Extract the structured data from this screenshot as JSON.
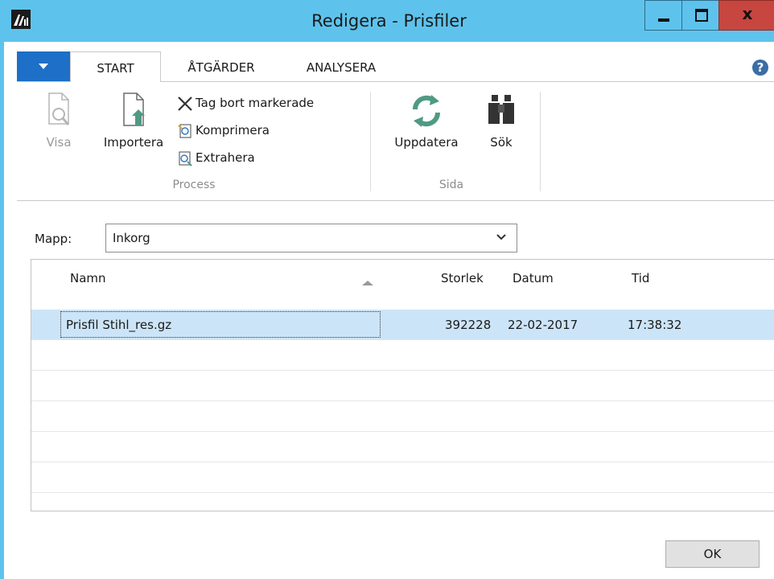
{
  "window": {
    "title": "Redigera - Prisfiler",
    "title_bar_color": "#5ec3ec",
    "close_button_color": "#c7463f",
    "minimize_label": "",
    "maximize_label": "",
    "close_label": "x"
  },
  "tabs": {
    "active_color": "#1d6fc7",
    "items": [
      {
        "label": "START",
        "active": true
      },
      {
        "label": "ÅTGÄRDER",
        "active": false
      },
      {
        "label": "ANALYSERA",
        "active": false
      }
    ],
    "help_label": "?"
  },
  "ribbon": {
    "groups": [
      {
        "label": "Process",
        "large_buttons": [
          {
            "label": "Visa",
            "icon": "view-icon",
            "enabled": false
          },
          {
            "label": "Importera",
            "icon": "import-icon",
            "enabled": true
          }
        ],
        "small_buttons": [
          {
            "label": "Tag bort markerade",
            "icon": "delete-icon"
          },
          {
            "label": "Komprimera",
            "icon": "compress-icon"
          },
          {
            "label": "Extrahera",
            "icon": "extract-icon"
          }
        ]
      },
      {
        "label": "Sida",
        "large_buttons": [
          {
            "label": "Uppdatera",
            "icon": "refresh-icon",
            "enabled": true
          },
          {
            "label": "Sök",
            "icon": "binoculars-icon",
            "enabled": true
          }
        ]
      }
    ]
  },
  "folder": {
    "label": "Mapp:",
    "value": "Inkorg"
  },
  "file_list": {
    "columns": [
      "Namn",
      "Storlek",
      "Datum",
      "Tid"
    ],
    "sorted_column": "Namn",
    "sort_direction": "ascending",
    "selection_color": "#cce4f7",
    "rows": [
      {
        "name": "Prisfil Stihl_res.gz",
        "size": "392228",
        "date": "22-02-2017",
        "time": "17:38:32",
        "selected": true
      }
    ]
  },
  "footer": {
    "ok_label": "OK"
  }
}
